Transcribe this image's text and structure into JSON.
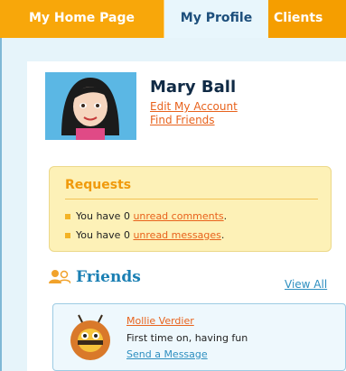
{
  "tabs": [
    {
      "label": "My Home Page"
    },
    {
      "label": "My Profile"
    },
    {
      "label": "Clients"
    }
  ],
  "profile": {
    "name": "Mary Ball",
    "edit_account": "Edit My Account",
    "find_friends": "Find Friends"
  },
  "requests": {
    "title": "Requests",
    "comments_prefix": "You have 0 ",
    "comments_link": "unread comments",
    "messages_prefix": "You have 0 ",
    "messages_link": "unread messages",
    "suffix": "."
  },
  "friends": {
    "title": "Friends",
    "view_all": "View All",
    "items": [
      {
        "name": "Mollie Verdier",
        "status": "First time on, having fun",
        "action": "Send a Message"
      }
    ]
  },
  "icons": {
    "friends": "friends-icon"
  },
  "colors": {
    "tab_orange": "#f5a100",
    "active_tab": "#e8f6fc",
    "link_orange": "#e8621c",
    "link_blue": "#2e8fc0",
    "requests_bg": "#fdf1b7"
  }
}
